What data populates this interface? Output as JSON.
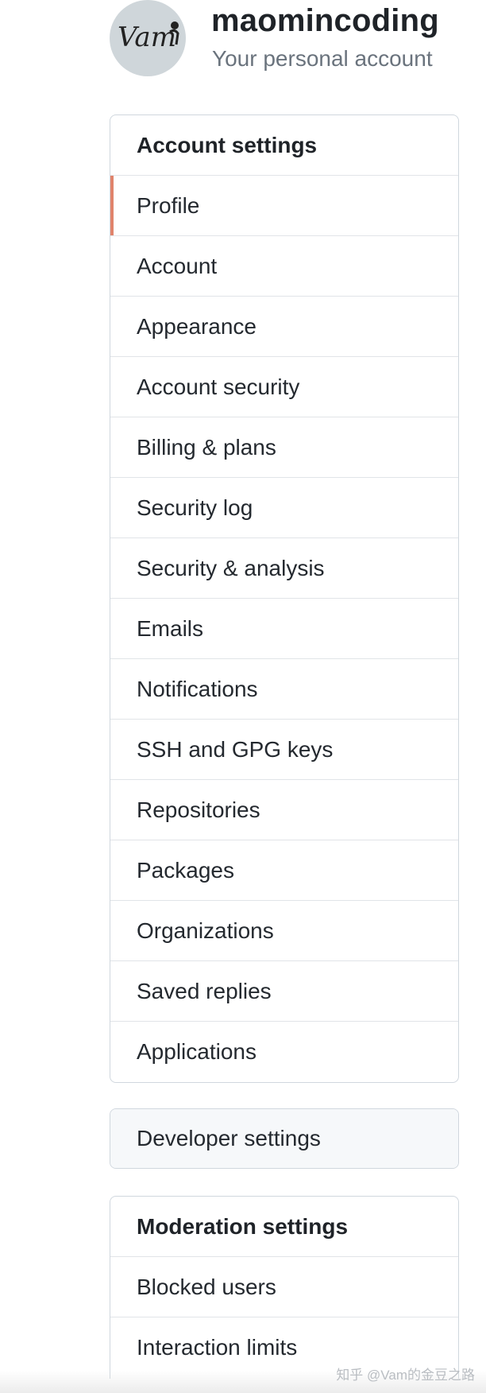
{
  "header": {
    "avatar_text": "Vam",
    "username": "maomincoding",
    "account_type": "Your personal account"
  },
  "account_settings": {
    "heading": "Account settings",
    "items": [
      {
        "label": "Profile",
        "selected": true
      },
      {
        "label": "Account"
      },
      {
        "label": "Appearance"
      },
      {
        "label": "Account security"
      },
      {
        "label": "Billing & plans"
      },
      {
        "label": "Security log"
      },
      {
        "label": "Security & analysis"
      },
      {
        "label": "Emails"
      },
      {
        "label": "Notifications"
      },
      {
        "label": "SSH and GPG keys"
      },
      {
        "label": "Repositories"
      },
      {
        "label": "Packages"
      },
      {
        "label": "Organizations"
      },
      {
        "label": "Saved replies"
      },
      {
        "label": "Applications"
      }
    ]
  },
  "developer_settings": {
    "label": "Developer settings"
  },
  "moderation_settings": {
    "heading": "Moderation settings",
    "items": [
      {
        "label": "Blocked users"
      },
      {
        "label": "Interaction limits"
      }
    ]
  },
  "watermark": "知乎 @Vam的金豆之路",
  "colors": {
    "selected_indicator": "#e0836b",
    "avatar_bg": "#cfd6da",
    "border": "#d0d7de",
    "muted_text": "#6a737d"
  }
}
